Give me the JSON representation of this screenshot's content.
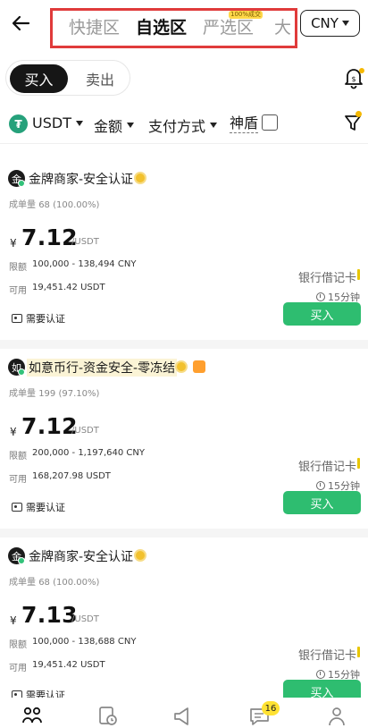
{
  "header": {
    "tabs": [
      {
        "label": "快捷区",
        "active": false
      },
      {
        "label": "自选区",
        "active": true
      },
      {
        "label": "严选区",
        "active": false
      },
      {
        "label": "大",
        "active": false
      }
    ],
    "tab_badge": "100%成交",
    "currency": "CNY"
  },
  "toggle": {
    "buy_label": "买入",
    "sell_label": "卖出"
  },
  "filters": {
    "coin": "USDT",
    "amount": "金额",
    "payment": "支付方式",
    "shield": "神盾"
  },
  "listings": [
    {
      "avatar_char": "金",
      "merchant": "金牌商家-安全认证",
      "highlight": false,
      "stat_label": "成单量",
      "stat_value": "68 (100.00%)",
      "currency_symbol": "¥",
      "price": "7.12",
      "price_unit": "/USDT",
      "limit_label": "限额",
      "limit_value": "100,000 - 138,494 CNY",
      "avail_label": "可用",
      "avail_value": "19,451.42 USDT",
      "payment": "银行借记卡",
      "time": "15分钟",
      "kyc": "需要认证",
      "button": "买入"
    },
    {
      "avatar_char": "如",
      "merchant": "如意币行-资金安全-零冻结",
      "highlight": true,
      "stat_label": "成单量",
      "stat_value": "199 (97.10%)",
      "currency_symbol": "¥",
      "price": "7.12",
      "price_unit": "/USDT",
      "limit_label": "限额",
      "limit_value": "200,000 - 1,197,640 CNY",
      "avail_label": "可用",
      "avail_value": "168,207.98 USDT",
      "payment": "银行借记卡",
      "time": "15分钟",
      "kyc": "需要认证",
      "button": "买入"
    },
    {
      "avatar_char": "金",
      "merchant": "金牌商家-安全认证",
      "highlight": false,
      "stat_label": "成单量",
      "stat_value": "68 (100.00%)",
      "currency_symbol": "¥",
      "price": "7.13",
      "price_unit": "/USDT",
      "limit_label": "限额",
      "limit_value": "100,000 - 138,688 CNY",
      "avail_label": "可用",
      "avail_value": "19,451.42 USDT",
      "payment": "银行借记卡",
      "time": "15分钟",
      "kyc": "需要认证",
      "button": "买入"
    }
  ],
  "bottom_nav": {
    "items": [
      {
        "icon": "p2p-icon"
      },
      {
        "icon": "orders-icon"
      },
      {
        "icon": "announcement-icon"
      },
      {
        "icon": "chat-icon"
      },
      {
        "icon": "profile-icon"
      }
    ],
    "chat_badge": "16"
  },
  "colors": {
    "accent_green": "#2ebd70",
    "highlight_box": "#e03b3b",
    "badge_yellow": "#ffe233"
  }
}
